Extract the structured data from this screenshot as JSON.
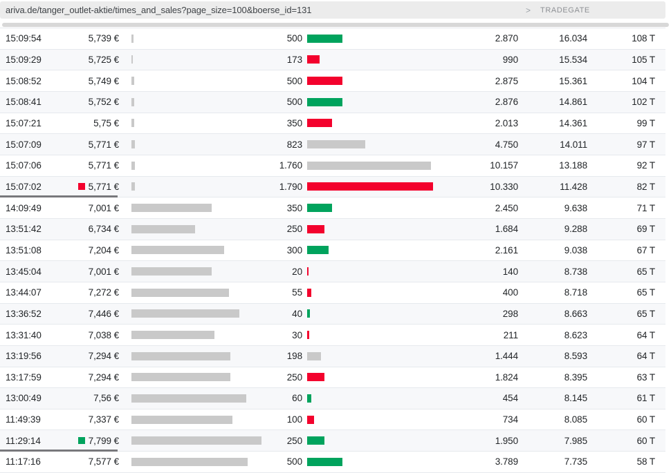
{
  "urlbar": {
    "url": "ariva.de/tanger_outlet-aktie/times_and_sales?page_size=100&boerse_id=131",
    "chevron": ">",
    "exchange": "TRADEGATE"
  },
  "colors": {
    "up": "#00a35d",
    "down": "#f3022d",
    "neutral": "#c9c9c9",
    "price_bar": "#c9c9c9",
    "marker_line": "#78787c"
  },
  "table": {
    "columns": [
      "time",
      "price",
      "price-bar",
      "volume",
      "volume-bar",
      "turnover",
      "cumulative-volume",
      "trade-count"
    ],
    "rows": [
      {
        "time": "15:09:54",
        "price": "5,739 €",
        "price_num": 5.739,
        "volume": "500",
        "volume_num": 500,
        "direction": "up",
        "turnover": "2.870",
        "cum_volume": "16.034",
        "trades": "108 T",
        "marker": null,
        "underline": false
      },
      {
        "time": "15:09:29",
        "price": "5,725 €",
        "price_num": 5.725,
        "volume": "173",
        "volume_num": 173,
        "direction": "down",
        "turnover": "990",
        "cum_volume": "15.534",
        "trades": "105 T",
        "marker": null,
        "underline": false
      },
      {
        "time": "15:08:52",
        "price": "5,749 €",
        "price_num": 5.749,
        "volume": "500",
        "volume_num": 500,
        "direction": "down",
        "turnover": "2.875",
        "cum_volume": "15.361",
        "trades": "104 T",
        "marker": null,
        "underline": false
      },
      {
        "time": "15:08:41",
        "price": "5,752 €",
        "price_num": 5.752,
        "volume": "500",
        "volume_num": 500,
        "direction": "up",
        "turnover": "2.876",
        "cum_volume": "14.861",
        "trades": "102 T",
        "marker": null,
        "underline": false
      },
      {
        "time": "15:07:21",
        "price": "5,75 €",
        "price_num": 5.75,
        "volume": "350",
        "volume_num": 350,
        "direction": "down",
        "turnover": "2.013",
        "cum_volume": "14.361",
        "trades": "99 T",
        "marker": null,
        "underline": false
      },
      {
        "time": "15:07:09",
        "price": "5,771 €",
        "price_num": 5.771,
        "volume": "823",
        "volume_num": 823,
        "direction": "neutral",
        "turnover": "4.750",
        "cum_volume": "14.011",
        "trades": "97 T",
        "marker": null,
        "underline": false
      },
      {
        "time": "15:07:06",
        "price": "5,771 €",
        "price_num": 5.771,
        "volume": "1.760",
        "volume_num": 1760,
        "direction": "neutral",
        "turnover": "10.157",
        "cum_volume": "13.188",
        "trades": "92 T",
        "marker": null,
        "underline": false
      },
      {
        "time": "15:07:02",
        "price": "5,771 €",
        "price_num": 5.771,
        "volume": "1.790",
        "volume_num": 1790,
        "direction": "down",
        "turnover": "10.330",
        "cum_volume": "11.428",
        "trades": "82 T",
        "marker": "down",
        "underline": true
      },
      {
        "time": "14:09:49",
        "price": "7,001 €",
        "price_num": 7.001,
        "volume": "350",
        "volume_num": 350,
        "direction": "up",
        "turnover": "2.450",
        "cum_volume": "9.638",
        "trades": "71 T",
        "marker": null,
        "underline": false
      },
      {
        "time": "13:51:42",
        "price": "6,734 €",
        "price_num": 6.734,
        "volume": "250",
        "volume_num": 250,
        "direction": "down",
        "turnover": "1.684",
        "cum_volume": "9.288",
        "trades": "69 T",
        "marker": null,
        "underline": false
      },
      {
        "time": "13:51:08",
        "price": "7,204 €",
        "price_num": 7.204,
        "volume": "300",
        "volume_num": 300,
        "direction": "up",
        "turnover": "2.161",
        "cum_volume": "9.038",
        "trades": "67 T",
        "marker": null,
        "underline": false
      },
      {
        "time": "13:45:04",
        "price": "7,001 €",
        "price_num": 7.001,
        "volume": "20",
        "volume_num": 20,
        "direction": "down",
        "turnover": "140",
        "cum_volume": "8.738",
        "trades": "65 T",
        "marker": null,
        "underline": false
      },
      {
        "time": "13:44:07",
        "price": "7,272 €",
        "price_num": 7.272,
        "volume": "55",
        "volume_num": 55,
        "direction": "down",
        "turnover": "400",
        "cum_volume": "8.718",
        "trades": "65 T",
        "marker": null,
        "underline": false
      },
      {
        "time": "13:36:52",
        "price": "7,446 €",
        "price_num": 7.446,
        "volume": "40",
        "volume_num": 40,
        "direction": "up",
        "turnover": "298",
        "cum_volume": "8.663",
        "trades": "65 T",
        "marker": null,
        "underline": false
      },
      {
        "time": "13:31:40",
        "price": "7,038 €",
        "price_num": 7.038,
        "volume": "30",
        "volume_num": 30,
        "direction": "down",
        "turnover": "211",
        "cum_volume": "8.623",
        "trades": "64 T",
        "marker": null,
        "underline": false
      },
      {
        "time": "13:19:56",
        "price": "7,294 €",
        "price_num": 7.294,
        "volume": "198",
        "volume_num": 198,
        "direction": "neutral",
        "turnover": "1.444",
        "cum_volume": "8.593",
        "trades": "64 T",
        "marker": null,
        "underline": false
      },
      {
        "time": "13:17:59",
        "price": "7,294 €",
        "price_num": 7.294,
        "volume": "250",
        "volume_num": 250,
        "direction": "down",
        "turnover": "1.824",
        "cum_volume": "8.395",
        "trades": "63 T",
        "marker": null,
        "underline": false
      },
      {
        "time": "13:00:49",
        "price": "7,56 €",
        "price_num": 7.56,
        "volume": "60",
        "volume_num": 60,
        "direction": "up",
        "turnover": "454",
        "cum_volume": "8.145",
        "trades": "61 T",
        "marker": null,
        "underline": false
      },
      {
        "time": "11:49:39",
        "price": "7,337 €",
        "price_num": 7.337,
        "volume": "100",
        "volume_num": 100,
        "direction": "down",
        "turnover": "734",
        "cum_volume": "8.085",
        "trades": "60 T",
        "marker": null,
        "underline": false
      },
      {
        "time": "11:29:14",
        "price": "7,799 €",
        "price_num": 7.799,
        "volume": "250",
        "volume_num": 250,
        "direction": "up",
        "turnover": "1.950",
        "cum_volume": "7.985",
        "trades": "60 T",
        "marker": "up",
        "underline": true
      },
      {
        "time": "11:17:16",
        "price": "7,577 €",
        "price_num": 7.577,
        "volume": "500",
        "volume_num": 500,
        "direction": "up",
        "turnover": "3.789",
        "cum_volume": "7.735",
        "trades": "58 T",
        "marker": null,
        "underline": false
      }
    ]
  }
}
